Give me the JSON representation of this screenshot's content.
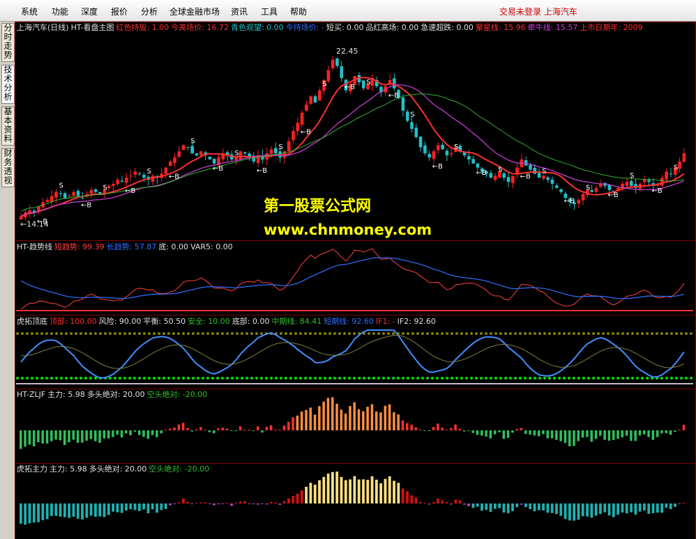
{
  "menu": {
    "items": [
      "系统",
      "功能",
      "深度",
      "报价",
      "分析",
      "全球金融市场",
      "资讯",
      "工具",
      "帮助"
    ],
    "status": "交易未登录  上海汽车"
  },
  "sidebar": {
    "tabs": [
      "分时走势",
      "技术分析",
      "基本资料",
      "财务透视"
    ]
  },
  "colors": {
    "up": "#ff2020",
    "down": "#20c0c8",
    "ma_short": "#ff3030",
    "ma_long": "#c040d0",
    "ma_green": "#30b030",
    "trend_short": "#ff4040",
    "trend_long": "#3070ff",
    "tiger_main": "#4090ff",
    "tiger_yellow": "#ffff00",
    "tiger_green": "#00e000"
  },
  "main_panel": {
    "title": "上海汽车(日线)",
    "indicator": "HT-看盘主图",
    "fields": [
      {
        "label": "红色持股:",
        "value": "1.00",
        "color": "#ff3030"
      },
      {
        "label": "今高场价:",
        "value": "16.72",
        "color": "#ff3030"
      },
      {
        "label": "青色观望:",
        "value": "0.00",
        "color": "#20c0c8"
      },
      {
        "label": "今持场价:",
        "value": "-",
        "color": "#3070ff"
      },
      {
        "label": "短买:",
        "value": "0.00",
        "color": "#e0e0e0"
      },
      {
        "label": "品红高场:",
        "value": "0.00",
        "color": "#e0e0e0"
      },
      {
        "label": "急速超跌:",
        "value": "0.00",
        "color": "#e0e0e0"
      },
      {
        "label": "聚星线:",
        "value": "15.96",
        "color": "#ff3030"
      },
      {
        "label": "牵牛线:",
        "value": "15.57",
        "color": "#d040d0"
      },
      {
        "label": "上市日期年:",
        "value": "2009",
        "color": "#ff3030"
      }
    ],
    "high_label": "22.45",
    "low_label": "14.14",
    "buy_marker": "B",
    "sell_marker": "S"
  },
  "trend_panel": {
    "title": "HT-趋势线",
    "fields": [
      {
        "label": "短趋势:",
        "value": "99.39",
        "color": "#ff4040"
      },
      {
        "label": "长趋势:",
        "value": "57.87",
        "color": "#3070ff"
      },
      {
        "label": "底:",
        "value": "0.00",
        "color": "#e0e0e0"
      },
      {
        "label": "VAR5:",
        "value": "0.00",
        "color": "#e0e0e0"
      }
    ]
  },
  "tiger_panel": {
    "title": "虎拓顶底",
    "fields": [
      {
        "label": "顶部:",
        "value": "100.00",
        "color": "#ff3030"
      },
      {
        "label": "风险:",
        "value": "90.00",
        "color": "#e0e0e0"
      },
      {
        "label": "平衡:",
        "value": "50.50",
        "color": "#e0e0e0"
      },
      {
        "label": "安全:",
        "value": "10.00",
        "color": "#30c030"
      },
      {
        "label": "底部:",
        "value": "0.00",
        "color": "#e0e0e0"
      },
      {
        "label": "中期线:",
        "value": "84.41",
        "color": "#30c030"
      },
      {
        "label": "短期线:",
        "value": "92.60",
        "color": "#3070ff"
      },
      {
        "label": "IF1:",
        "value": "-",
        "color": "#ff3030"
      },
      {
        "label": "IF2:",
        "value": "92.60",
        "color": "#e0e0e0"
      }
    ]
  },
  "zljf_panel": {
    "title": "HT-ZLJF",
    "fields": [
      {
        "label": "主力:",
        "value": "5.98",
        "color": "#e0e0e0"
      },
      {
        "label": "多头绝对:",
        "value": "20.00",
        "color": "#e0e0e0"
      },
      {
        "label": "空头绝对:",
        "value": "-20.00",
        "color": "#30c030"
      }
    ]
  },
  "tiger_main_panel": {
    "title": "虎拓主力",
    "fields": [
      {
        "label": "主力:",
        "value": "5.98",
        "color": "#e0e0e0"
      },
      {
        "label": "多头绝对:",
        "value": "20.00",
        "color": "#e0e0e0"
      },
      {
        "label": "空头绝对:",
        "value": "-20.00",
        "color": "#30c030"
      }
    ]
  },
  "watermark": {
    "line1": "第一股票公式网",
    "line2": "www.chnmoney.com"
  },
  "chart_data": {
    "type": "candlestick",
    "ylim": [
      13.5,
      23.5
    ],
    "closes": [
      14.4,
      14.6,
      14.7,
      14.6,
      14.9,
      15.1,
      15.2,
      15.4,
      15.6,
      15.5,
      15.3,
      15.4,
      15.6,
      15.4,
      15.3,
      15.5,
      15.7,
      15.6,
      15.5,
      15.7,
      15.9,
      16.0,
      16.2,
      16.1,
      16.3,
      16.4,
      16.6,
      16.5,
      16.3,
      16.2,
      16.4,
      16.3,
      16.5,
      16.8,
      17.1,
      17.3,
      17.6,
      17.9,
      17.8,
      17.5,
      17.4,
      17.6,
      17.4,
      17.2,
      17.0,
      17.3,
      17.5,
      17.4,
      17.2,
      17.3,
      17.6,
      17.5,
      17.3,
      17.1,
      17.4,
      17.2,
      17.5,
      17.7,
      17.5,
      17.3,
      17.6,
      18.1,
      18.6,
      19.0,
      19.5,
      19.9,
      20.3,
      20.0,
      20.6,
      21.1,
      21.6,
      22.1,
      21.8,
      21.2,
      20.6,
      20.9,
      21.3,
      21.0,
      20.7,
      20.9,
      21.2,
      20.8,
      20.5,
      20.8,
      21.1,
      20.7,
      20.2,
      19.6,
      19.1,
      18.7,
      18.3,
      17.8,
      17.5,
      17.3,
      17.6,
      17.9,
      17.7,
      17.4,
      17.5,
      17.8,
      17.6,
      17.4,
      17.2,
      17.0,
      16.8,
      16.6,
      16.5,
      16.3,
      16.4,
      16.6,
      16.3,
      16.1,
      16.4,
      16.8,
      17.2,
      16.9,
      16.7,
      16.5,
      16.3,
      16.4,
      16.2,
      16.0,
      15.8,
      15.6,
      15.3,
      15.1,
      15.0,
      15.2,
      15.5,
      15.7,
      15.6,
      15.8,
      16.0,
      15.9,
      15.7,
      15.6,
      15.8,
      16.0,
      16.1,
      15.9,
      15.8,
      16.0,
      16.2,
      16.1,
      15.9,
      16.0,
      16.3,
      16.6,
      16.5,
      16.8,
      17.1,
      17.5
    ]
  }
}
